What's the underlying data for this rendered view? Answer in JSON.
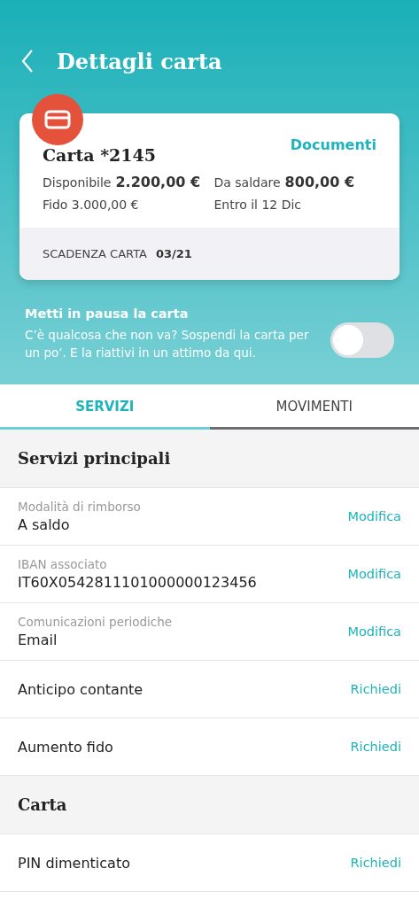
{
  "header": {
    "title": "Dettagli carta"
  },
  "card": {
    "name": "Carta *2145",
    "link": "Documenti",
    "available_label": "Disponibile",
    "available_value": "2.200,00 €",
    "credit_line": "Fido 3.000,00 €",
    "due_label": "Da saldare",
    "due_value": "800,00 €",
    "due_date": "Entro il 12 Dic",
    "expiry_label": "SCADENZA CARTA",
    "expiry_value": "03/21"
  },
  "pause": {
    "title": "Metti in pausa la carta",
    "text": "C’è qualcosa che non va? Sospendi la carta per un po’. E la riattivi in un attimo da qui.",
    "on": false
  },
  "tabs": [
    {
      "label": "SERVIZI",
      "selected": true
    },
    {
      "label": "MOVIMENTI",
      "selected": false
    }
  ],
  "sections": [
    {
      "title": "Servizi principali",
      "rows": [
        {
          "kind": "field",
          "label": "Modalità di rimborso",
          "value": "A saldo",
          "action": "Modifica"
        },
        {
          "kind": "field",
          "label": "IBAN associato",
          "value": "IT60X0542811101000000123456",
          "action": "Modifica"
        },
        {
          "kind": "field",
          "label": "Comunicazioni periodiche",
          "value": "Email",
          "action": "Modifica"
        },
        {
          "kind": "plain",
          "value": "Anticipo contante",
          "action": "Richiedi"
        },
        {
          "kind": "plain",
          "value": "Aumento fido",
          "action": "Richiedi"
        }
      ]
    },
    {
      "title": "Carta",
      "rows": [
        {
          "kind": "plain",
          "value": "PIN dimenticato",
          "action": "Richiedi"
        }
      ]
    }
  ]
}
